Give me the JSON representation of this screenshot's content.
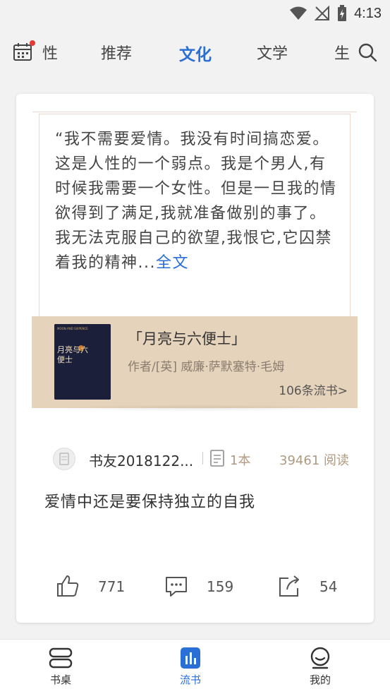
{
  "status": {
    "time": "4:13"
  },
  "tabs": [
    {
      "label": "性"
    },
    {
      "label": "推荐"
    },
    {
      "label": "文化",
      "active": true
    },
    {
      "label": "文学"
    },
    {
      "label": "生"
    }
  ],
  "card": {
    "quote": "“我不需要爱情。我没有时间搞恋爱。这是人性的一个弱点。我是个男人,有时候我需要一个女性。但是一旦我的情欲得到了满足,我就准备做别的事了。我无法克服自己的欲望,我恨它,它囚禁着我的精神...",
    "quote_more": "全文",
    "book": {
      "cover_text_top": "MOON AND SIXPENCE",
      "cover_title": "月亮与六便士",
      "title": "「月亮与六便士」",
      "author": "作者/[英] 威廉·萨默塞特·毛姆",
      "count": "106条流书>"
    },
    "user": {
      "name": "书友2018122...",
      "books": "1本",
      "reads": "39461 阅读"
    },
    "comment": "爱情中还是要保持独立的自我",
    "actions": {
      "likes": "771",
      "comments": "159",
      "shares": "54"
    }
  },
  "bottom_nav": [
    {
      "label": "书桌"
    },
    {
      "label": "流书",
      "active": true
    },
    {
      "label": "我的"
    }
  ],
  "colors": {
    "accent": "#2a6fd6",
    "strip": "#e6d3bb",
    "notify": "#e53935"
  }
}
